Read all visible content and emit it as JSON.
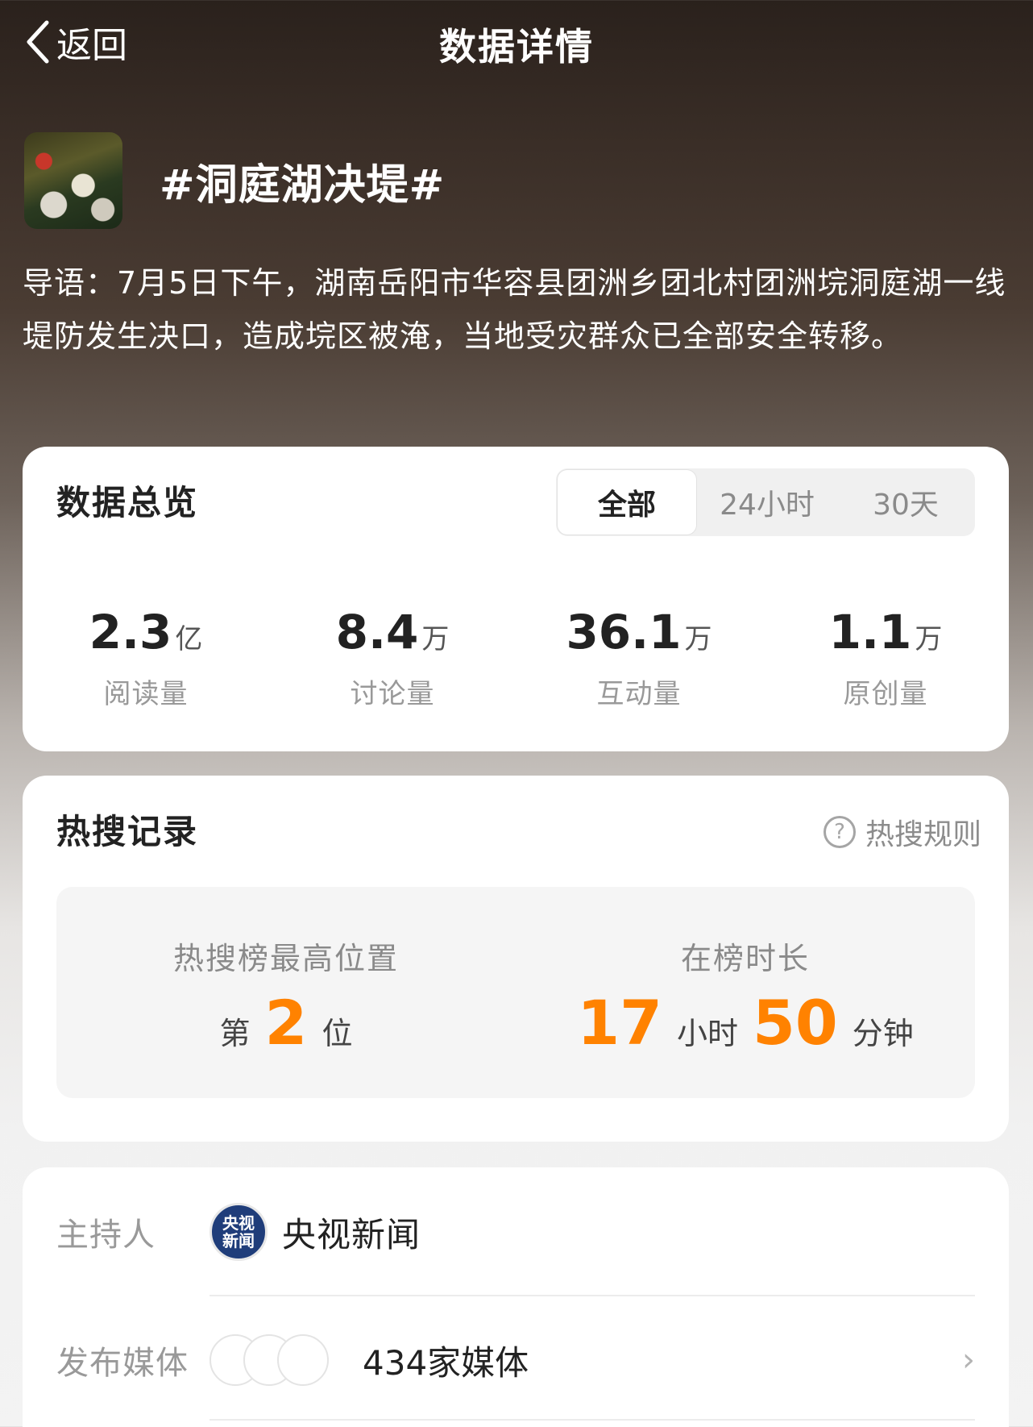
{
  "nav": {
    "back_label": "返回",
    "title": "数据详情"
  },
  "topic": {
    "title": "#洞庭湖决堤#"
  },
  "lead": "导语：7月5日下午，湖南岳阳市华容县团洲乡团北村团洲垸洞庭湖一线堤防发生决口，造成垸区被淹，当地受灾群众已全部安全转移。",
  "overview": {
    "title": "数据总览",
    "tabs": [
      {
        "label": "全部",
        "active": true
      },
      {
        "label": "24小时",
        "active": false
      },
      {
        "label": "30天",
        "active": false
      }
    ],
    "stats": [
      {
        "value": "2.3",
        "unit": "亿",
        "label": "阅读量"
      },
      {
        "value": "8.4",
        "unit": "万",
        "label": "讨论量"
      },
      {
        "value": "36.1",
        "unit": "万",
        "label": "互动量"
      },
      {
        "value": "1.1",
        "unit": "万",
        "label": "原创量"
      }
    ]
  },
  "hot": {
    "title": "热搜记录",
    "rules_label": "热搜规则",
    "peak": {
      "label": "热搜榜最高位置",
      "prefix": "第",
      "value": "2",
      "suffix": "位"
    },
    "duration": {
      "label": "在榜时长",
      "hours": "17",
      "hours_unit": "小时",
      "minutes": "50",
      "minutes_unit": "分钟"
    }
  },
  "info": {
    "host_label": "主持人",
    "host_name": "央视新闻",
    "host_logo": {
      "top": "央视",
      "bottom": "新闻"
    },
    "media_label": "发布媒体",
    "media_count": "434家媒体"
  },
  "colors": {
    "accent": "#ff8200",
    "logo_bg": "#1f3d7a"
  }
}
